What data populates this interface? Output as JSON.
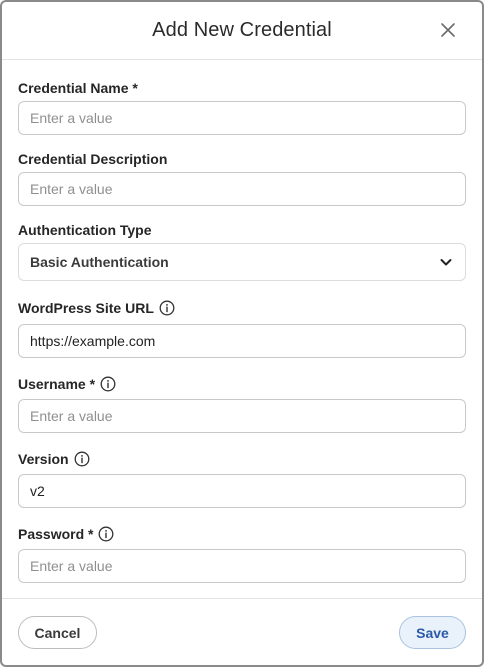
{
  "dialog": {
    "title": "Add New Credential"
  },
  "fields": {
    "credential_name": {
      "label": "Credential Name *",
      "value": "",
      "placeholder": "Enter a value"
    },
    "credential_description": {
      "label": "Credential Description",
      "value": "",
      "placeholder": "Enter a value"
    },
    "authentication_type": {
      "label": "Authentication Type",
      "selected": "Basic Authentication"
    },
    "site_url": {
      "label": "WordPress Site URL",
      "value": "https://example.com",
      "placeholder": ""
    },
    "username": {
      "label": "Username *",
      "value": "",
      "placeholder": "Enter a value"
    },
    "version": {
      "label": "Version",
      "value": "v2",
      "placeholder": ""
    },
    "password": {
      "label": "Password *",
      "value": "",
      "placeholder": "Enter a value"
    }
  },
  "footer": {
    "cancel_label": "Cancel",
    "save_label": "Save"
  },
  "icons": {
    "close": "close-icon",
    "info": "info-icon",
    "chevron": "chevron-down-icon"
  },
  "colors": {
    "save_text": "#2a5aa8",
    "save_bg": "#e9f1fb"
  }
}
